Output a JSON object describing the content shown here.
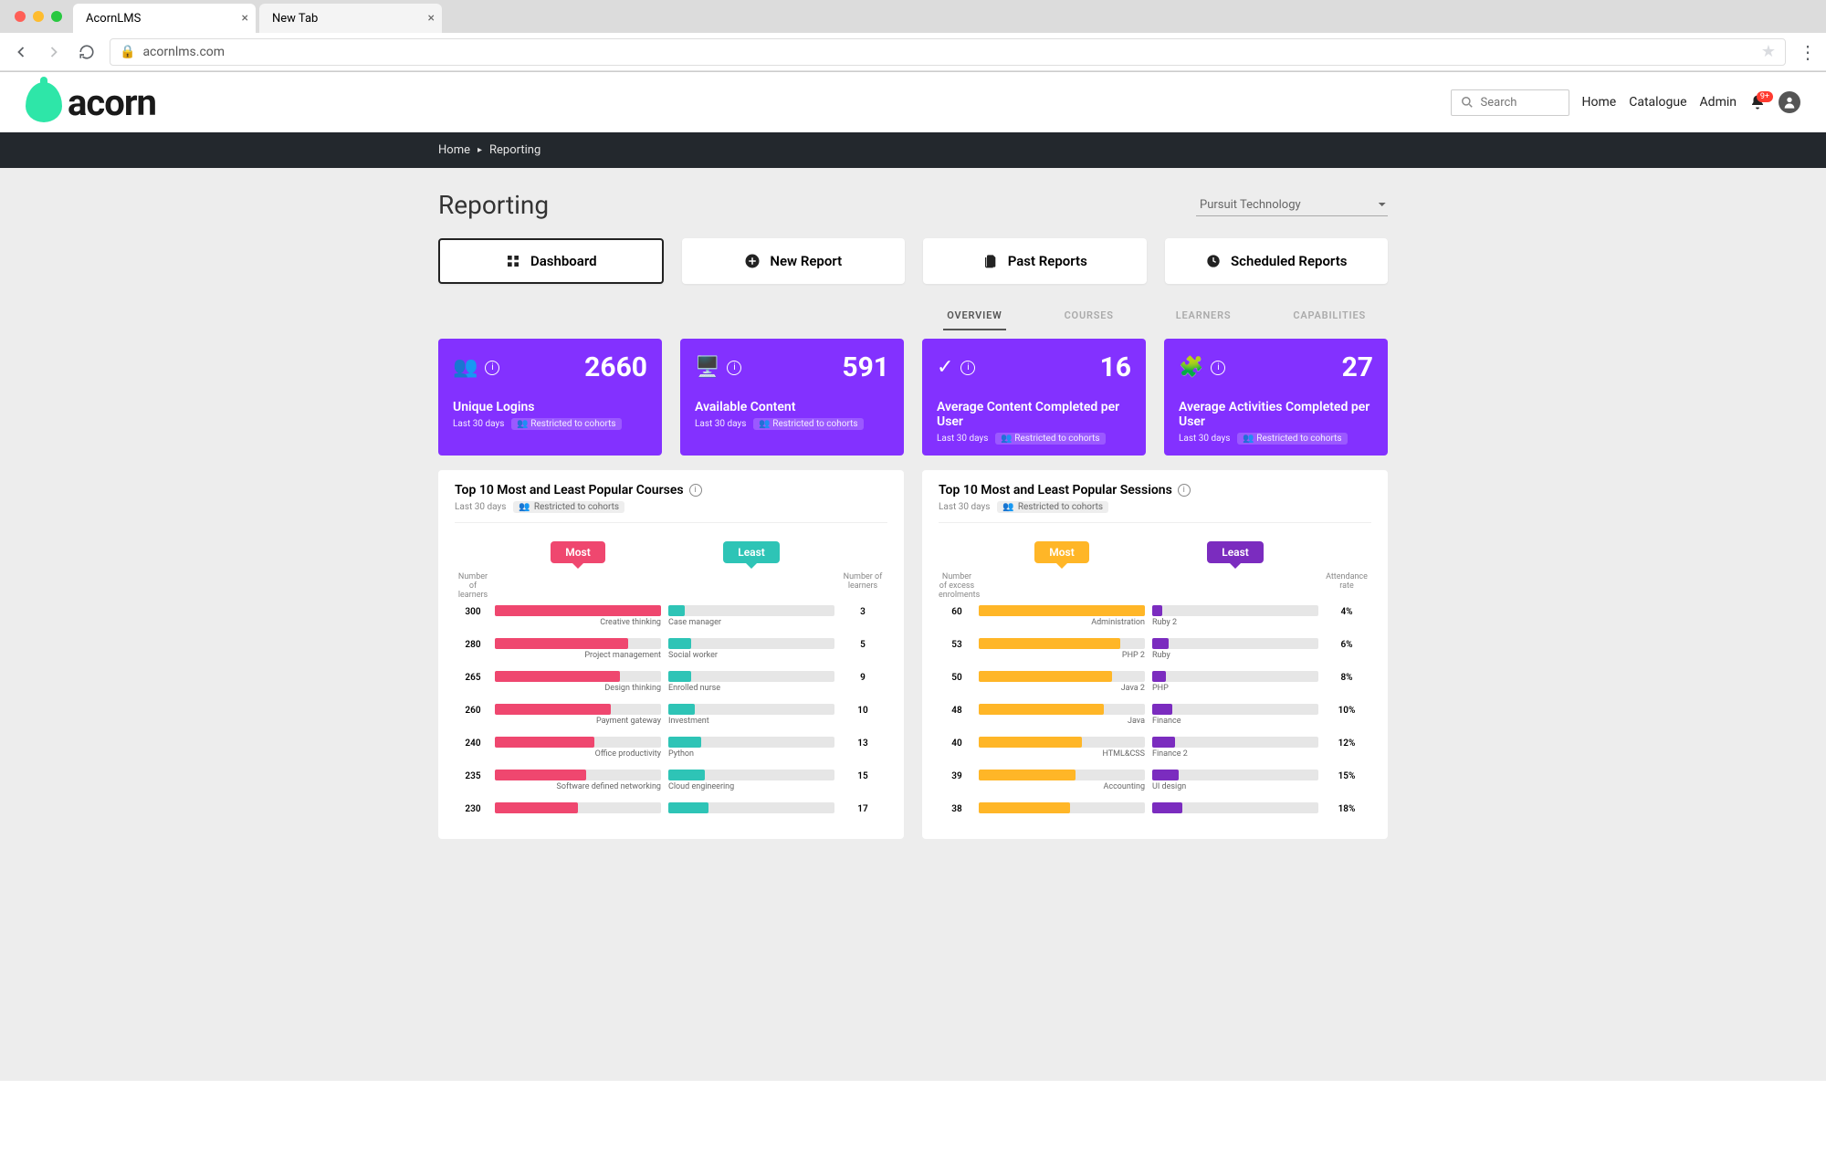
{
  "browser": {
    "tabs": [
      {
        "title": "AcornLMS",
        "active": true
      },
      {
        "title": "New Tab",
        "active": false
      }
    ],
    "url": "acornlms.com"
  },
  "header": {
    "logo_text": "acorn",
    "search_placeholder": "Search",
    "nav": [
      "Home",
      "Catalogue",
      "Admin"
    ],
    "notification_badge": "9+"
  },
  "breadcrumb": [
    "Home",
    "Reporting"
  ],
  "page": {
    "title": "Reporting",
    "org_selected": "Pursuit Technology"
  },
  "report_buttons": [
    {
      "label": "Dashboard",
      "icon": "grid",
      "active": true
    },
    {
      "label": "New Report",
      "icon": "plus",
      "active": false
    },
    {
      "label": "Past Reports",
      "icon": "doc",
      "active": false
    },
    {
      "label": "Scheduled Reports",
      "icon": "clock",
      "active": false
    }
  ],
  "sub_tabs": [
    {
      "label": "OVERVIEW",
      "active": true
    },
    {
      "label": "COURSES",
      "active": false
    },
    {
      "label": "LEARNERS",
      "active": false
    },
    {
      "label": "CAPABILITIES",
      "active": false
    }
  ],
  "kpis": [
    {
      "icon": "users",
      "value": "2660",
      "label": "Unique Logins",
      "period": "Last 30 days",
      "chip": "Restricted to cohorts"
    },
    {
      "icon": "monitor",
      "value": "591",
      "label": "Available Content",
      "period": "Last 30 days",
      "chip": "Restricted to cohorts"
    },
    {
      "icon": "browser-check",
      "value": "16",
      "label": "Average Content Completed per User",
      "period": "Last 30 days",
      "chip": "Restricted to cohorts"
    },
    {
      "icon": "puzzle",
      "value": "27",
      "label": "Average Activities Completed per User",
      "period": "Last 30 days",
      "chip": "Restricted to cohorts"
    }
  ],
  "charts": {
    "courses": {
      "title": "Top 10 Most and Least Popular Courses",
      "period": "Last 30 days",
      "chip": "Restricted to cohorts",
      "most_label": "Most",
      "least_label": "Least",
      "left_axis": "Number of learners",
      "right_axis": "Number of learners",
      "rows": [
        {
          "most_val": 300,
          "most_label": "Creative thinking",
          "most_pct": 100,
          "least_val": 3,
          "least_label": "Case manager",
          "least_pct": 10
        },
        {
          "most_val": 280,
          "most_label": "Project management",
          "most_pct": 80,
          "least_val": 5,
          "least_label": "Social worker",
          "least_pct": 14
        },
        {
          "most_val": 265,
          "most_label": "Design thinking",
          "most_pct": 75,
          "least_val": 9,
          "least_label": "Enrolled nurse",
          "least_pct": 14
        },
        {
          "most_val": 260,
          "most_label": "Payment gateway",
          "most_pct": 70,
          "least_val": 10,
          "least_label": "Investment",
          "least_pct": 16
        },
        {
          "most_val": 240,
          "most_label": "Office productivity",
          "most_pct": 60,
          "least_val": 13,
          "least_label": "Python",
          "least_pct": 20
        },
        {
          "most_val": 235,
          "most_label": "Software defined networking",
          "most_pct": 55,
          "least_val": 15,
          "least_label": "Cloud engineering",
          "least_pct": 22
        },
        {
          "most_val": 230,
          "most_label": "",
          "most_pct": 50,
          "least_val": 17,
          "least_label": "",
          "least_pct": 24
        }
      ]
    },
    "sessions": {
      "title": "Top 10 Most and Least Popular Sessions",
      "period": "Last 30 days",
      "chip": "Restricted to cohorts",
      "most_label": "Most",
      "least_label": "Least",
      "left_axis": "Number of excess enrolments",
      "right_axis": "Attendance rate",
      "rows": [
        {
          "most_val": 60,
          "most_label": "Administration",
          "most_pct": 100,
          "least_val": "4%",
          "least_label": "Ruby 2",
          "least_pct": 6
        },
        {
          "most_val": 53,
          "most_label": "PHP 2",
          "most_pct": 85,
          "least_val": "6%",
          "least_label": "Ruby",
          "least_pct": 10
        },
        {
          "most_val": 50,
          "most_label": "Java 2",
          "most_pct": 80,
          "least_val": "8%",
          "least_label": "PHP",
          "least_pct": 8
        },
        {
          "most_val": 48,
          "most_label": "Java",
          "most_pct": 75,
          "least_val": "10%",
          "least_label": "Finance",
          "least_pct": 12
        },
        {
          "most_val": 40,
          "most_label": "HTML&CSS",
          "most_pct": 62,
          "least_val": "12%",
          "least_label": "Finance 2",
          "least_pct": 14
        },
        {
          "most_val": 39,
          "most_label": "Accounting",
          "most_pct": 58,
          "least_val": "15%",
          "least_label": "UI design",
          "least_pct": 16
        },
        {
          "most_val": 38,
          "most_label": "",
          "most_pct": 55,
          "least_val": "18%",
          "least_label": "",
          "least_pct": 18
        }
      ]
    }
  },
  "chart_data": [
    {
      "type": "bar",
      "title": "Top 10 Most and Least Popular Courses",
      "series": [
        {
          "name": "Most",
          "categories": [
            "Creative thinking",
            "Project management",
            "Design thinking",
            "Payment gateway",
            "Office productivity",
            "Software defined networking"
          ],
          "values": [
            300,
            280,
            265,
            260,
            240,
            235
          ],
          "ylabel": "Number of learners"
        },
        {
          "name": "Least",
          "categories": [
            "Case manager",
            "Social worker",
            "Enrolled nurse",
            "Investment",
            "Python",
            "Cloud engineering"
          ],
          "values": [
            3,
            5,
            9,
            10,
            13,
            15
          ],
          "ylabel": "Number of learners"
        }
      ]
    },
    {
      "type": "bar",
      "title": "Top 10 Most and Least Popular Sessions",
      "series": [
        {
          "name": "Most",
          "categories": [
            "Administration",
            "PHP 2",
            "Java 2",
            "Java",
            "HTML&CSS",
            "Accounting"
          ],
          "values": [
            60,
            53,
            50,
            48,
            40,
            39
          ],
          "ylabel": "Number of excess enrolments"
        },
        {
          "name": "Least",
          "categories": [
            "Ruby 2",
            "Ruby",
            "PHP",
            "Finance",
            "Finance 2",
            "UI design"
          ],
          "values": [
            4,
            6,
            8,
            10,
            12,
            15
          ],
          "ylabel": "Attendance rate (%)"
        }
      ]
    }
  ]
}
